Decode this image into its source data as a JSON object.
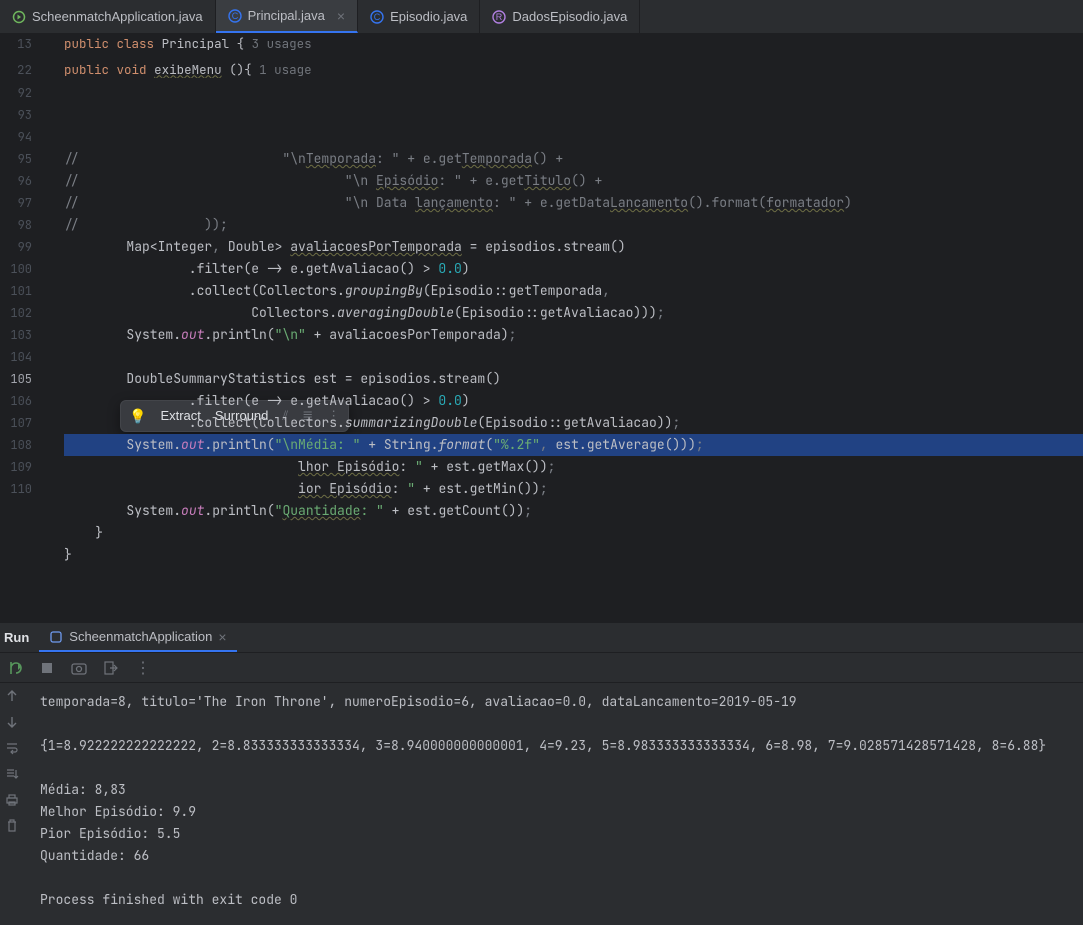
{
  "tabs": [
    {
      "label": "ScheenmatchApplication.java",
      "iconColor": "#6FB65D",
      "active": false
    },
    {
      "label": "Principal.java",
      "iconColor": "#3574F0",
      "active": true,
      "closable": true
    },
    {
      "label": "Episodio.java",
      "iconColor": "#3574F0",
      "active": false
    },
    {
      "label": "DadosEpisodio.java",
      "iconColor": "#B07FE0",
      "active": false
    }
  ],
  "breadcrumb": {
    "line1": "13",
    "line2": "22",
    "kw_public": "public",
    "kw_class": "class",
    "class_name": "Principal",
    "brace": " {",
    "usages1": "3 usages",
    "kw_void": "void",
    "method": "exibeMenu",
    "parens": "(){",
    "usages2": "1 usage"
  },
  "lines": [
    {
      "n": 92,
      "html": "<span class='cmt'>//                          \"\\n<span class='wavy'>Temporada</span>: \" + e.get<span class='wavy'>Temporada</span>() +</span>"
    },
    {
      "n": 93,
      "html": "<span class='cmt'>//                                  \"\\n <span class='wavy'>Episódio</span>: \" + e.get<span class='wavy'>Titulo</span>() +</span>"
    },
    {
      "n": 94,
      "html": "<span class='cmt'>//                                  \"\\n Data <span class='wavy'>lançamento</span>: \" + e.getData<span class='wavy'>Lancamento</span>().format(<span class='wavy'>formatador</span>)</span>"
    },
    {
      "n": 95,
      "html": "<span class='cmt'>//                ));</span>"
    },
    {
      "n": 96,
      "html": "        Map&lt;Integer<span class='cmt'>,</span> Double&gt; <span class='wavy'>avaliacoesPorTemporada</span> = episodios.stream()"
    },
    {
      "n": 97,
      "html": "                .filter(e -> e.getAvaliacao() > <span class='num'>0.0</span>)"
    },
    {
      "n": 98,
      "html": "                .collect(Collectors.<span class='it'>groupingBy</span>(Episodio::getTemporada<span class='cmt'>,</span>"
    },
    {
      "n": 99,
      "html": "                        Collectors.<span class='it'>averagingDouble</span>(Episodio::getAvaliacao)))<span class='cmt'>;</span>"
    },
    {
      "n": 100,
      "html": "        System.<span class='pale'>out</span>.println(<span class='str'>\"\\n\"</span> + avaliacoesPorTemporada)<span class='cmt'>;</span>"
    },
    {
      "n": 101,
      "html": ""
    },
    {
      "n": 102,
      "html": "        DoubleSummaryStatistics est = episodios.stream()"
    },
    {
      "n": 103,
      "html": "                .filter(e -> e.getAvaliacao() > <span class='num'>0.0</span>)"
    },
    {
      "n": 104,
      "html": "                .collect(Collectors.<span class='it'>summarizingDouble</span>(Episodio::getAvaliacao))<span class='cmt'>;</span>"
    },
    {
      "n": 105,
      "hl": true,
      "html": "        System.<span class='pale'>out</span>.println(<span class='str'>\"\\nMédia: \"</span> + String.<span class='it'>format</span>(<span class='str'>\"%.2f\"</span><span class='cmt'>,</span> est.getAverage()))<span class='cmt'>;</span>"
    },
    {
      "n": 106,
      "html": "                              <span class='wavy'>lhor Episódio</span>: <span class='str'>\"</span> + est.getMax())<span class='cmt'>;</span>"
    },
    {
      "n": 107,
      "html": "                              <span class='wavy'>ior Episódio</span>: <span class='str'>\"</span> + est.getMin())<span class='cmt'>;</span>"
    },
    {
      "n": 108,
      "html": "        System.<span class='pale'>out</span>.println(<span class='str'>\"<span class='wavy'>Quantidade</span>: \"</span> + est.getCount())<span class='cmt'>;</span>"
    },
    {
      "n": 109,
      "html": "    }"
    },
    {
      "n": 110,
      "html": "}"
    }
  ],
  "popup": {
    "extract": "Extract",
    "surround": "Surround"
  },
  "run": {
    "title": "Run",
    "config": "ScheenmatchApplication",
    "output": "temporada=8, titulo='The Iron Throne', numeroEpisodio=6, avaliacao=0.0, dataLancamento=2019-05-19\n\n{1=8.922222222222222, 2=8.833333333333334, 3=8.940000000000001, 4=9.23, 5=8.983333333333334, 6=8.98, 7=9.028571428571428, 8=6.88}\n\nMédia: 8,83\nMelhor Episódio: 9.9\nPior Episódio: 5.5\nQuantidade: 66\n\nProcess finished with exit code 0"
  }
}
